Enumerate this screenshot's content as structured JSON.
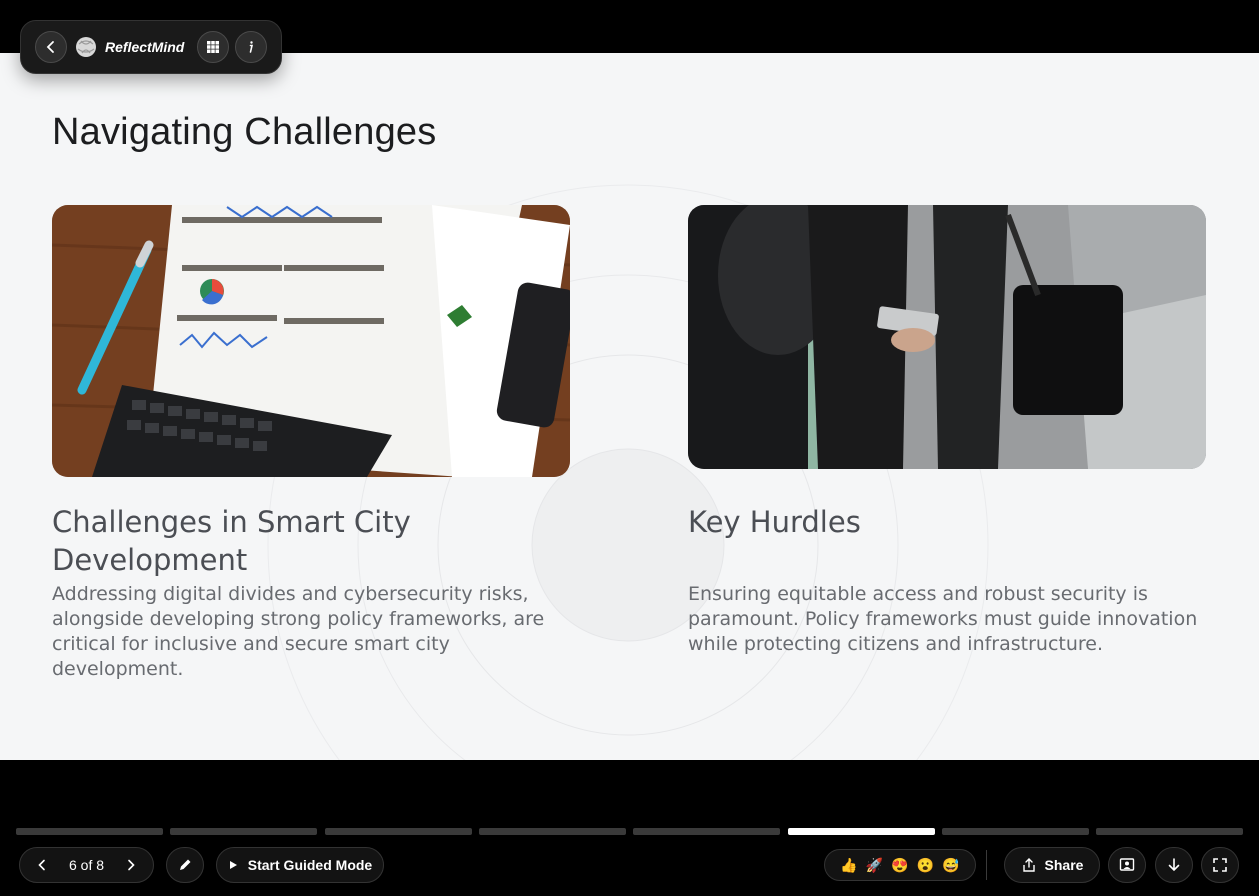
{
  "app": {
    "brand": "ReflectMind"
  },
  "slide": {
    "title": "Navigating Challenges",
    "left": {
      "heading_line1": "Challenges in Smart City",
      "heading_line2": "Development",
      "body": "Addressing digital divides and cybersecurity risks, alongside developing strong policy frameworks, are critical for inclusive and secure smart city development."
    },
    "right": {
      "heading": "Key Hurdles",
      "body": "Ensuring equitable access and robust security is paramount. Policy frameworks must guide innovation while protecting citizens and infrastructure."
    }
  },
  "progress": {
    "total": 8,
    "current": 6
  },
  "controls": {
    "page_indicator": "6 of 8",
    "guided_mode_label": "Start Guided Mode",
    "share_label": "Share",
    "reactions": [
      "👍",
      "🚀",
      "😍",
      "😮",
      "😅"
    ]
  },
  "colors": {
    "slide_bg": "#f5f6f7",
    "bar_bg": "#000000",
    "accent": "#ffffff"
  }
}
